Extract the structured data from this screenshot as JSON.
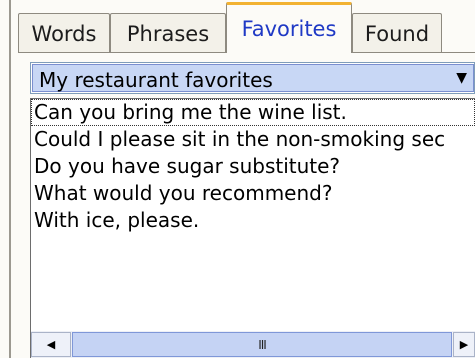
{
  "tabs": [
    {
      "label": "Words",
      "active": false
    },
    {
      "label": "Phrases",
      "active": false
    },
    {
      "label": "Favorites",
      "active": true
    },
    {
      "label": "Found",
      "active": false
    }
  ],
  "favorites_dropdown": {
    "selected": "My restaurant favorites",
    "arrow_icon": "▼"
  },
  "phrase_list": {
    "items": [
      "Can you bring me the wine list.",
      "Could I please sit in the non-smoking sec",
      "Do you have sugar substitute?",
      "What would you recommend?",
      "With ice, please."
    ]
  },
  "scrollbar": {
    "left_icon": "◀",
    "right_icon": "▶",
    "grip": "III"
  },
  "colors": {
    "active_tab_text": "#1f39c5",
    "active_tab_accent": "#f2b232",
    "dropdown_bg": "#c8d7f5"
  }
}
